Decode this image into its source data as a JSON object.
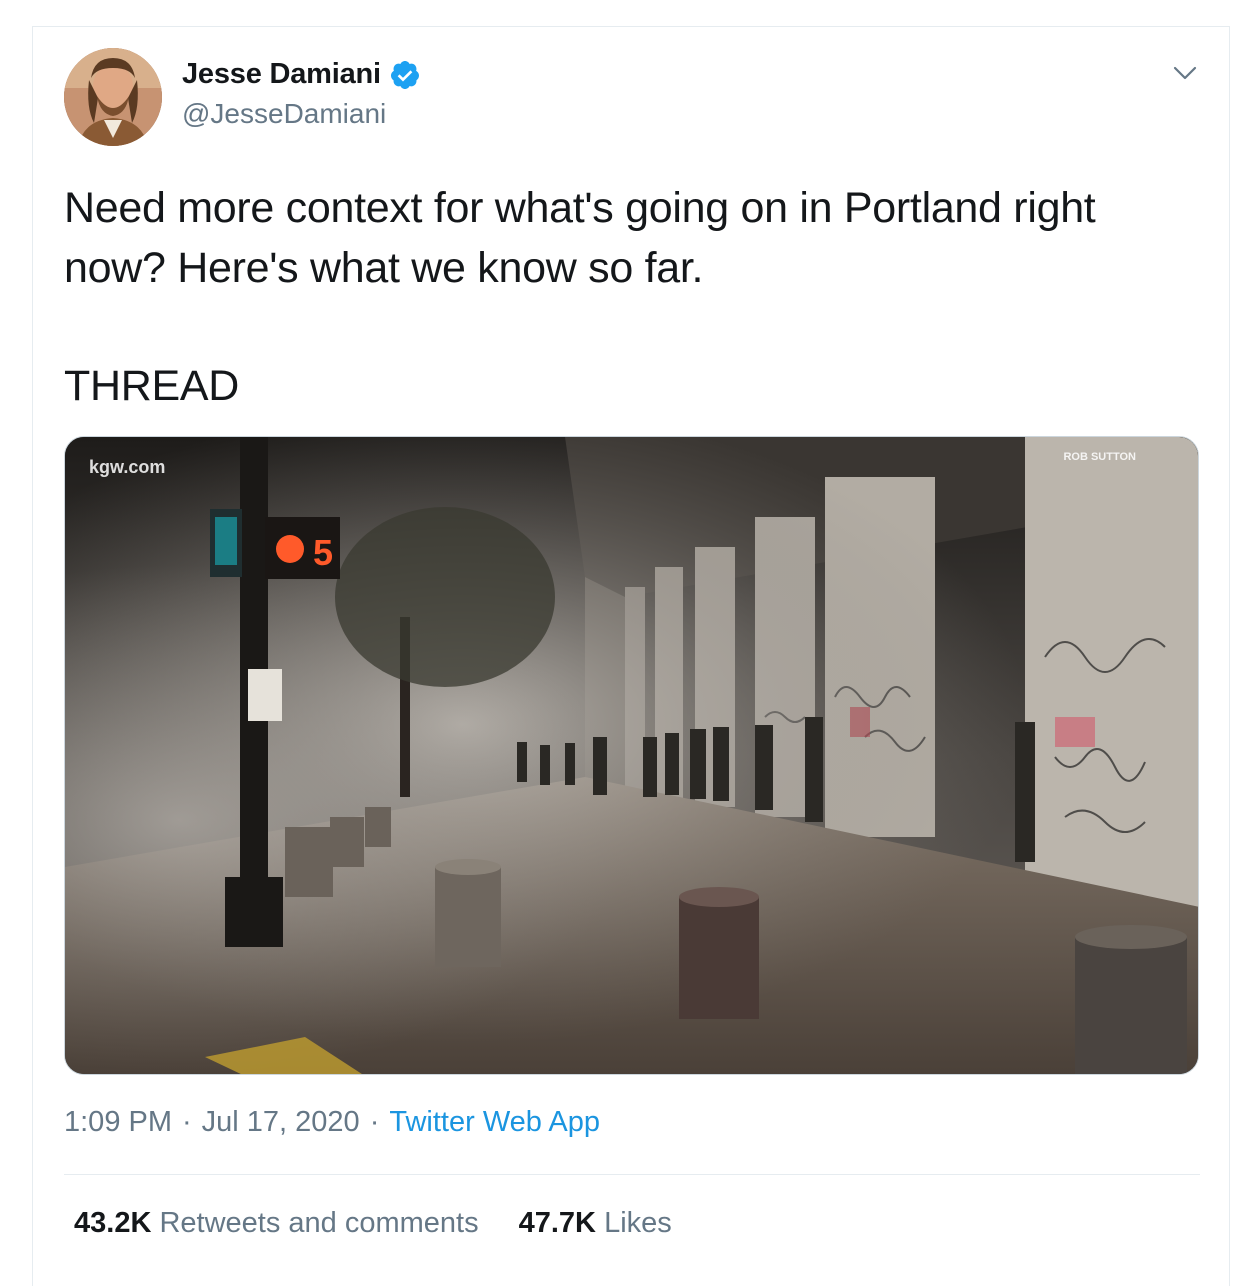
{
  "author": {
    "display_name": "Jesse Damiani",
    "handle": "@JesseDamiani",
    "verified": true,
    "avatar_icon": "user-avatar"
  },
  "tweet": {
    "paragraphs": [
      "Need more context for what's going on in Portland right now? Here's what we know so far.",
      "THREAD"
    ]
  },
  "media": {
    "watermark": "kgw.com",
    "credit": "ROB SUTTON",
    "signal_digit": "5"
  },
  "meta": {
    "time": "1:09 PM",
    "separator1": "·",
    "date": "Jul 17, 2020",
    "separator2": "·",
    "source": "Twitter Web App"
  },
  "stats": {
    "retweets_count": "43.2K",
    "retweets_label": "Retweets and comments",
    "likes_count": "47.7K",
    "likes_label": "Likes"
  },
  "colors": {
    "accent": "#1b95e0",
    "verified": "#1da1f2",
    "muted": "#657786",
    "text": "#14171a"
  }
}
